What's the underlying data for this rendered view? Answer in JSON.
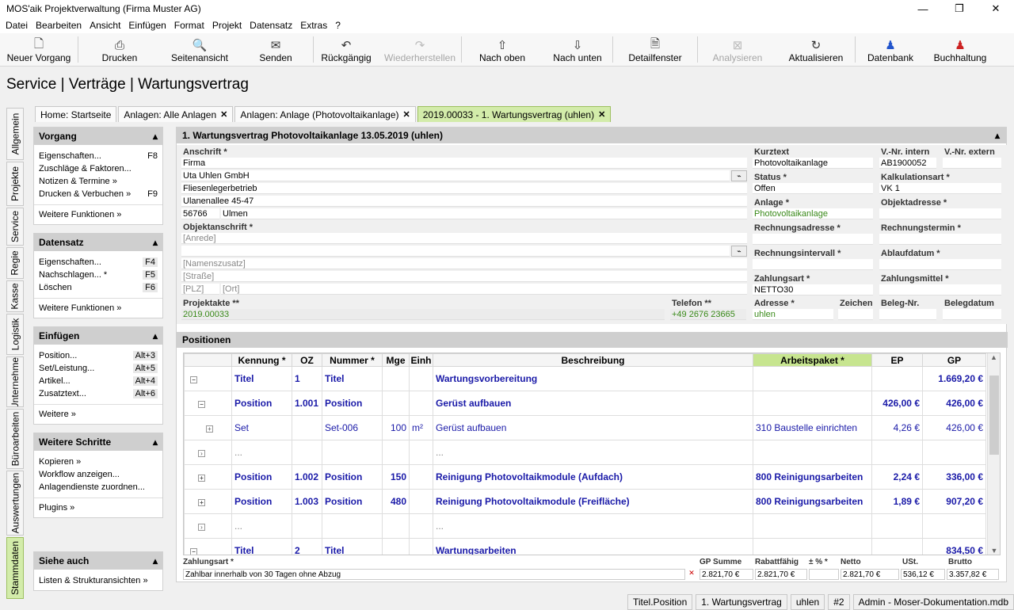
{
  "window": {
    "title": "MOS'aik Projektverwaltung (Firma Muster AG)",
    "minimize": "—",
    "maximize": "❐",
    "close": "✕"
  },
  "menu": [
    "Datei",
    "Bearbeiten",
    "Ansicht",
    "Einfügen",
    "Format",
    "Projekt",
    "Datensatz",
    "Extras",
    "?"
  ],
  "toolbar": {
    "neuer_vorgang": "Neuer Vorgang",
    "drucken": "Drucken",
    "seitenansicht": "Seitenansicht",
    "senden": "Senden",
    "rueckgaengig": "Rückgängig",
    "wiederherstellen": "Wiederherstellen",
    "nach_oben": "Nach oben",
    "nach_unten": "Nach unten",
    "detailfenster": "Detailfenster",
    "analysieren": "Analysieren",
    "aktualisieren": "Aktualisieren",
    "datenbank": "Datenbank",
    "buchhaltung": "Buchhaltung"
  },
  "page_title": "Service | Verträge | Wartungsvertrag",
  "tabs": [
    "Home: Startseite",
    "Anlagen: Alle Anlagen",
    "Anlagen: Anlage (Photovoltaikanlage)",
    "2019.00033 - 1. Wartungsvertrag (uhlen)"
  ],
  "vtabs": [
    "Allgemein",
    "Projekte",
    "Service",
    "Regie",
    "Kasse",
    "Logistik",
    "Unternehmer",
    "Büroarbeiten",
    "Auswertungen",
    "Stammdaten"
  ],
  "left": {
    "vorgang": {
      "title": "Vorgang",
      "items": [
        [
          "Eigenschaften...",
          "F8"
        ],
        [
          "Zuschläge & Faktoren...",
          ""
        ],
        [
          "Notizen & Termine »",
          ""
        ],
        [
          "Drucken & Verbuchen »",
          "F9"
        ]
      ],
      "more": "Weitere Funktionen »"
    },
    "datensatz": {
      "title": "Datensatz",
      "items": [
        [
          "Eigenschaften...",
          "F4"
        ],
        [
          "Nachschlagen... *",
          "F5"
        ],
        [
          "Löschen",
          "F6"
        ]
      ],
      "more": "Weitere Funktionen »"
    },
    "einfuegen": {
      "title": "Einfügen",
      "items": [
        [
          "Position...",
          "Alt+3"
        ],
        [
          "Set/Leistung...",
          "Alt+5"
        ],
        [
          "Artikel...",
          "Alt+4"
        ],
        [
          "Zusatztext...",
          "Alt+6"
        ]
      ],
      "more": "Weitere »"
    },
    "schritte": {
      "title": "Weitere Schritte",
      "items": [
        "Kopieren »",
        "Workflow anzeigen...",
        "Anlagendienste zuordnen..."
      ],
      "more": "Plugins »"
    },
    "siehe": {
      "title": "Siehe auch",
      "items": [
        "Listen & Strukturansichten »"
      ]
    }
  },
  "header": {
    "title": "1. Wartungsvertrag Photovoltaikanlage 13.05.2019 (uhlen)",
    "caret": "▴"
  },
  "form": {
    "anschrift_label": "Anschrift *",
    "anschrift": [
      "Firma",
      "Uta Uhlen GmbH",
      "Fliesenlegerbetrieb",
      "Ulanenallee 45-47"
    ],
    "plz": "56766",
    "ort": "Ulmen",
    "objekt_label": "Objektanschrift *",
    "objekt": [
      "[Anrede]",
      "",
      "[Namenszusatz]",
      "[Straße]"
    ],
    "objekt_plz": "[PLZ]",
    "objekt_ort": "[Ort]",
    "projektakte_label": "Projektakte **",
    "projektakte": "2019.00033",
    "telefon_label": "Telefon **",
    "telefon": "+49 2676 23665",
    "kurztext_label": "Kurztext",
    "kurztext": "Photovoltaikanlage",
    "vnr_label": "V.-Nr. intern",
    "vnr": "AB1900052",
    "vnr_ext_label": "V.-Nr. extern",
    "vnr_ext": "",
    "status_label": "Status *",
    "status": "Offen",
    "kalk_label": "Kalkulationsart *",
    "kalk": "VK 1",
    "anlage_label": "Anlage *",
    "anlage": "Photovoltaikanlage",
    "objektadresse_label": "Objektadresse *",
    "rechnungsadresse_label": "Rechnungsadresse *",
    "rechnungstermin_label": "Rechnungstermin *",
    "rechnungsintervall_label": "Rechnungsintervall *",
    "ablaufdatum_label": "Ablaufdatum *",
    "zahlungsart_label": "Zahlungsart *",
    "zahlungsart": "NETTO30",
    "zahlungsmittel_label": "Zahlungsmittel *",
    "adresse_label": "Adresse *",
    "adresse": "uhlen",
    "zeichen_label": "Zeichen",
    "belegnr_label": "Beleg-Nr.",
    "belegdatum_label": "Belegdatum"
  },
  "positionen": {
    "title": "Positionen",
    "columns": [
      "Kennung *",
      "OZ",
      "Nummer *",
      "Mge",
      "Einh",
      "Beschreibung",
      "Arbeitspaket *",
      "EP",
      "GP"
    ],
    "rows": [
      {
        "k": "Titel",
        "oz": "1",
        "nr": "Titel",
        "mge": "",
        "einh": "",
        "beschr": "Wartungsvorbereitung",
        "ap": "",
        "ep": "",
        "gp": "1.669,20 €",
        "cls": "bold"
      },
      {
        "k": "Position",
        "oz": "1.001",
        "nr": "Position",
        "mge": "",
        "einh": "",
        "beschr": "Gerüst aufbauen",
        "ap": "",
        "ep": "426,00 €",
        "gp": "426,00 €",
        "cls": "bold"
      },
      {
        "k": "Set",
        "oz": "",
        "nr": "Set-006",
        "mge": "100",
        "einh": "m²",
        "beschr": "Gerüst aufbauen",
        "ap": "310 Baustelle einrichten",
        "ep": "4,26 €",
        "gp": "426,00 €",
        "cls": "blue"
      },
      {
        "k": "...",
        "oz": "",
        "nr": "",
        "mge": "",
        "einh": "",
        "beschr": "...",
        "ap": "",
        "ep": "",
        "gp": "",
        "cls": ""
      },
      {
        "k": "Position",
        "oz": "1.002",
        "nr": "Position",
        "mge": "150",
        "einh": "",
        "beschr": "Reinigung Photovoltaikmodule (Aufdach)",
        "ap": "800 Reinigungsarbeiten",
        "ep": "2,24 €",
        "gp": "336,00 €",
        "cls": "bold"
      },
      {
        "k": "Position",
        "oz": "1.003",
        "nr": "Position",
        "mge": "480",
        "einh": "",
        "beschr": "Reinigung Photovoltaikmodule (Freifläche)",
        "ap": "800 Reinigungsarbeiten",
        "ep": "1,89 €",
        "gp": "907,20 €",
        "cls": "bold"
      },
      {
        "k": "...",
        "oz": "",
        "nr": "",
        "mge": "",
        "einh": "",
        "beschr": "...",
        "ap": "",
        "ep": "",
        "gp": "",
        "cls": ""
      },
      {
        "k": "Titel",
        "oz": "2",
        "nr": "Titel",
        "mge": "",
        "einh": "",
        "beschr": "Wartungsarbeiten",
        "ap": "",
        "ep": "",
        "gp": "834,50 €",
        "cls": "bold"
      }
    ]
  },
  "summary": {
    "zahlungsart_label": "Zahlungsart *",
    "zahlungsart": "Zahlbar innerhalb von 30 Tagen ohne Abzug",
    "gp_summe_label": "GP Summe",
    "gp_summe": "2.821,70 €",
    "rabatt_label": "Rabattfähig",
    "rabatt": "2.821,70 €",
    "pct_label": "± % *",
    "pct": "",
    "netto_label": "Netto",
    "netto": "2.821,70 €",
    "ust_label": "USt.",
    "ust": "536,12 €",
    "brutto_label": "Brutto",
    "brutto": "3.357,82 €"
  },
  "statusbar": [
    "Titel.Position",
    "1. Wartungsvertrag",
    "uhlen",
    "#2",
    "Admin - Moser-Dokumentation.mdb"
  ]
}
